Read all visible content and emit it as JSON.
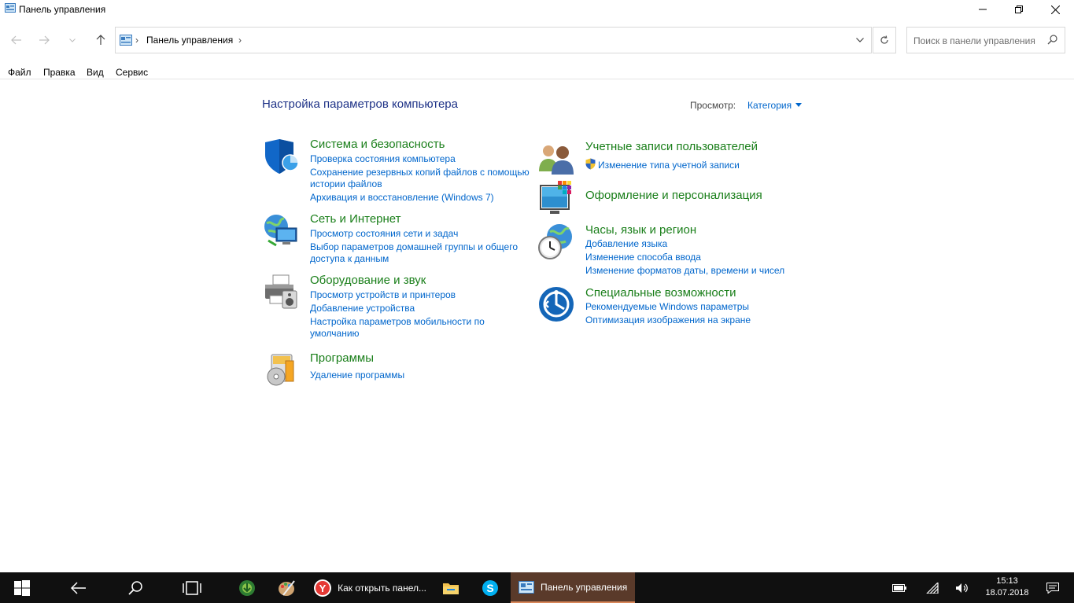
{
  "window": {
    "title": "Панель управления"
  },
  "navigation": {
    "breadcrumb": "Панель управления",
    "search_placeholder": "Поиск в панели управления"
  },
  "menu": {
    "items": [
      "Файл",
      "Правка",
      "Вид",
      "Сервис"
    ]
  },
  "main": {
    "title": "Настройка параметров компьютера",
    "view_label": "Просмотр:",
    "view_value": "Категория"
  },
  "categories": {
    "system": {
      "title": "Система и безопасность",
      "links": [
        "Проверка состояния компьютера",
        "Сохранение резервных копий файлов с помощью",
        "истории файлов",
        "Архивация и восстановление (Windows 7)"
      ]
    },
    "network": {
      "title": "Сеть и Интернет",
      "links": [
        "Просмотр состояния сети и задач",
        "Выбор параметров домашней группы и общего",
        "доступа к данным"
      ]
    },
    "hardware": {
      "title": "Оборудование и звук",
      "links": [
        "Просмотр устройств и принтеров",
        "Добавление устройства",
        "Настройка параметров мобильности по",
        "умолчанию"
      ]
    },
    "programs": {
      "title": "Программы",
      "links": [
        "Удаление программы"
      ]
    },
    "accounts": {
      "title": "Учетные записи пользователей",
      "links": [
        "Изменение типа учетной записи"
      ]
    },
    "appearance": {
      "title": "Оформление и персонализация",
      "links": []
    },
    "clock": {
      "title": "Часы, язык и регион",
      "links": [
        "Добавление языка",
        "Изменение способа ввода",
        "Изменение форматов даты, времени и чисел"
      ]
    },
    "access": {
      "title": "Специальные возможности",
      "links": [
        "Рекомендуемые Windows параметры",
        "Оптимизация изображения на экране"
      ]
    }
  },
  "taskbar": {
    "apps": [
      {
        "label": "Как открыть панел...",
        "icon": "yandex-browser-icon"
      },
      {
        "label": "Панель управления",
        "icon": "control-panel-icon"
      }
    ],
    "time": "15:13",
    "date": "18.07.2018"
  },
  "colors": {
    "category_title": "#1a7f1a",
    "link": "#0066cc",
    "page_title": "#1e3287",
    "taskbar": "#101010"
  }
}
